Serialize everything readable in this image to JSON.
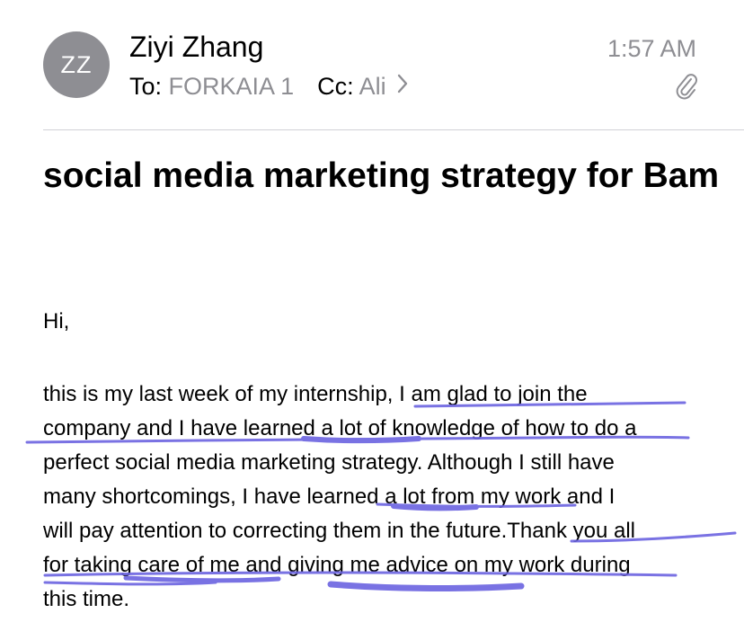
{
  "header": {
    "avatar_initials": "ZZ",
    "sender_name": "Ziyi Zhang",
    "time": "1:57 AM",
    "to_label": "To:",
    "to_value": "FORKAIA 1",
    "cc_label": "Cc:",
    "cc_value": "Ali",
    "icons": {
      "disclosure": "chevron-right-icon",
      "attachment": "paperclip-icon"
    },
    "colors": {
      "avatar_bg": "#8e8e93",
      "secondary_text": "#8e8e93"
    }
  },
  "message": {
    "subject": "social media marketing strategy for Bam",
    "greeting": "Hi,",
    "body_lines": [
      "this is my last week of my internship, I am glad to join the",
      "company and I have learned a lot of knowledge of how to do a",
      "perfect social media marketing strategy. Although I still have",
      "many shortcomings, I have learned a lot from my work and I",
      "will pay attention to correcting them in the future.Thank you all",
      "for taking care of me and giving me advice on my work during",
      "this time."
    ]
  },
  "annotations": {
    "ink_color": "#6b63e0"
  }
}
